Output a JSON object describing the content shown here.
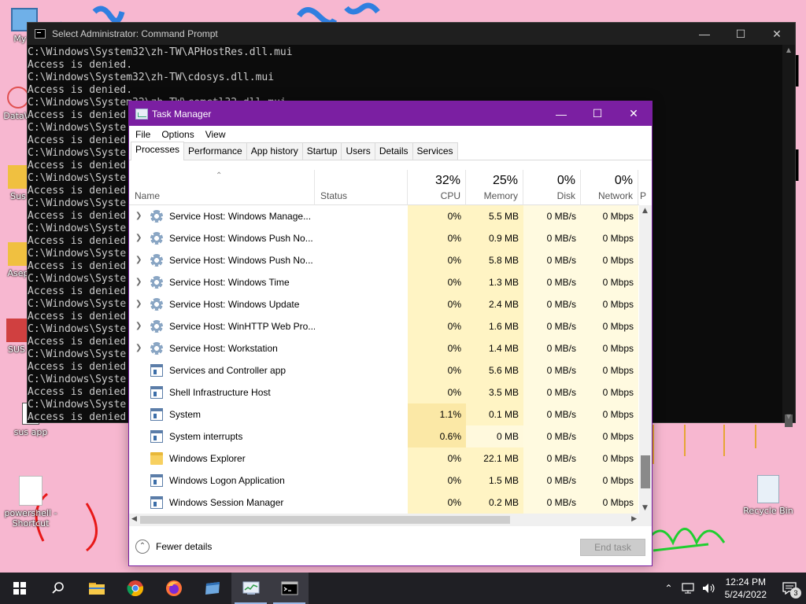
{
  "desktop": {
    "icons": [
      {
        "label": "My C"
      },
      {
        "label": "DataW"
      },
      {
        "label": "Sus"
      },
      {
        "label": "Asep"
      },
      {
        "label": "SUS"
      },
      {
        "label": "sus app"
      },
      {
        "label": "powershell - Shortcut"
      },
      {
        "label": "Recycle Bin"
      }
    ]
  },
  "cmd": {
    "title": "Select Administrator: Command Prompt",
    "lines": "C:\\Windows\\System32\\zh-TW\\APHostRes.dll.mui\nAccess is denied.\nC:\\Windows\\System32\\zh-TW\\cdosys.dll.mui\nAccess is denied.\nC:\\Windows\\System32\\zh-TW\\comctl32.dll.mui\nAccess is denied.\nC:\\Windows\\Syste\nAccess is denied\nC:\\Windows\\Syste\nAccess is denied\nC:\\Windows\\Syste\nAccess is denied\nC:\\Windows\\Syste\nAccess is denied\nC:\\Windows\\Syste\nAccess is denied\nC:\\Windows\\Syste\nAccess is denied\nC:\\Windows\\Syste\nAccess is denied\nC:\\Windows\\Syste\nAccess is denied\nC:\\Windows\\Syste\nAccess is denied\nC:\\Windows\\Syste\nAccess is denied\nC:\\Windows\\Syste\nAccess is denied\nC:\\Windows\\Syste\nAccess is denied\nC:\\Windows\\Syste\nAccess is denied\n\nC:\\WINDOWS\\syste"
  },
  "taskmgr": {
    "title": "Task Manager",
    "menu": [
      "File",
      "Options",
      "View"
    ],
    "tabs": [
      "Processes",
      "Performance",
      "App history",
      "Startup",
      "Users",
      "Details",
      "Services"
    ],
    "columns": {
      "name": "Name",
      "status": "Status",
      "cpu": {
        "pct": "32%",
        "label": "CPU"
      },
      "memory": {
        "pct": "25%",
        "label": "Memory"
      },
      "disk": {
        "pct": "0%",
        "label": "Disk"
      },
      "network": {
        "pct": "0%",
        "label": "Network"
      },
      "extra": "P"
    },
    "rows": [
      {
        "name": "Service Host: Windows Manage...",
        "cpu": "0%",
        "mem": "5.5 MB",
        "disk": "0 MB/s",
        "net": "0 Mbps",
        "icon": "gear-icon",
        "expand": true
      },
      {
        "name": "Service Host: Windows Push No...",
        "cpu": "0%",
        "mem": "0.9 MB",
        "disk": "0 MB/s",
        "net": "0 Mbps",
        "icon": "gear-icon",
        "expand": true
      },
      {
        "name": "Service Host: Windows Push No...",
        "cpu": "0%",
        "mem": "5.8 MB",
        "disk": "0 MB/s",
        "net": "0 Mbps",
        "icon": "gear-icon",
        "expand": true
      },
      {
        "name": "Service Host: Windows Time",
        "cpu": "0%",
        "mem": "1.3 MB",
        "disk": "0 MB/s",
        "net": "0 Mbps",
        "icon": "gear-icon",
        "expand": true
      },
      {
        "name": "Service Host: Windows Update",
        "cpu": "0%",
        "mem": "2.4 MB",
        "disk": "0 MB/s",
        "net": "0 Mbps",
        "icon": "gear-icon",
        "expand": true
      },
      {
        "name": "Service Host: WinHTTP Web Pro...",
        "cpu": "0%",
        "mem": "1.6 MB",
        "disk": "0 MB/s",
        "net": "0 Mbps",
        "icon": "gear-icon",
        "expand": true
      },
      {
        "name": "Service Host: Workstation",
        "cpu": "0%",
        "mem": "1.4 MB",
        "disk": "0 MB/s",
        "net": "0 Mbps",
        "icon": "gear-icon",
        "expand": true
      },
      {
        "name": "Services and Controller app",
        "cpu": "0%",
        "mem": "5.6 MB",
        "disk": "0 MB/s",
        "net": "0 Mbps",
        "icon": "app-window-icon",
        "expand": false
      },
      {
        "name": "Shell Infrastructure Host",
        "cpu": "0%",
        "mem": "3.5 MB",
        "disk": "0 MB/s",
        "net": "0 Mbps",
        "icon": "app-window-icon",
        "expand": false
      },
      {
        "name": "System",
        "cpu": "1.1%",
        "mem": "0.1 MB",
        "disk": "0 MB/s",
        "net": "0 Mbps",
        "icon": "app-window-icon",
        "expand": false
      },
      {
        "name": "System interrupts",
        "cpu": "0.6%",
        "mem": "0 MB",
        "disk": "0 MB/s",
        "net": "0 Mbps",
        "icon": "app-window-icon",
        "expand": false
      },
      {
        "name": "Windows Explorer",
        "cpu": "0%",
        "mem": "22.1 MB",
        "disk": "0 MB/s",
        "net": "0 Mbps",
        "icon": "folder-icon",
        "expand": false
      },
      {
        "name": "Windows Logon Application",
        "cpu": "0%",
        "mem": "1.5 MB",
        "disk": "0 MB/s",
        "net": "0 Mbps",
        "icon": "app-window-icon",
        "expand": false
      },
      {
        "name": "Windows Session Manager",
        "cpu": "0%",
        "mem": "0.2 MB",
        "disk": "0 MB/s",
        "net": "0 Mbps",
        "icon": "app-window-icon",
        "expand": false
      }
    ],
    "fewer_details": "Fewer details",
    "end_task": "End task"
  },
  "taskbar": {
    "time": "12:24 PM",
    "date": "5/24/2022",
    "notifications": "3"
  }
}
